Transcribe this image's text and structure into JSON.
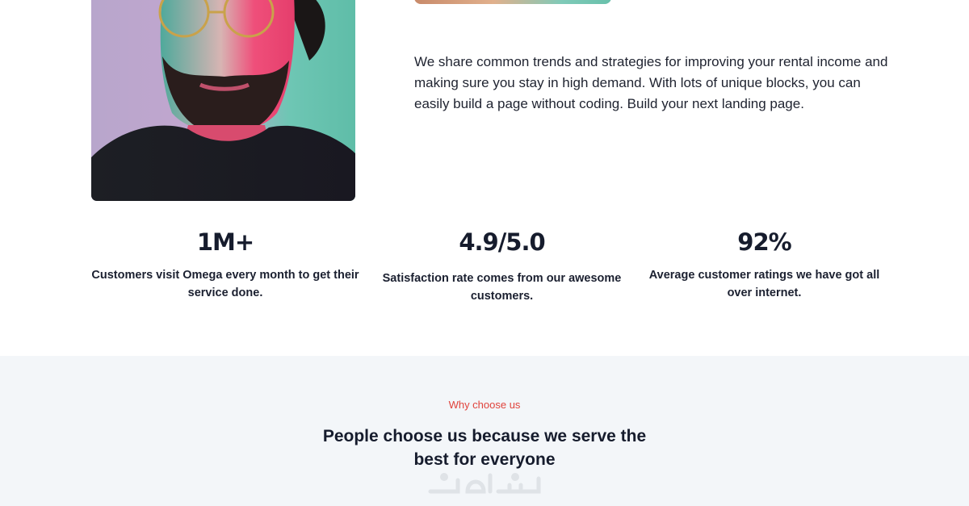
{
  "intro": {
    "text": "We share common trends and strategies for improving your rental income and making sure you stay in high demand. With lots of unique blocks, you can easily build a page without coding. Build your next landing page."
  },
  "stats": [
    {
      "value": "1M+",
      "description": "Customers visit Omega every month to get their service done."
    },
    {
      "value": "4.9/5.0",
      "description": "Satisfaction rate comes from our awesome customers."
    },
    {
      "value": "92%",
      "description": "Average customer ratings we have got all over internet."
    }
  ],
  "why": {
    "eyebrow": "Why choose us",
    "heading": "People choose us because we serve the best for everyone"
  },
  "colors": {
    "accent": "#e0433c",
    "heading": "#161c2d",
    "section_bg": "#f3f6f9"
  }
}
